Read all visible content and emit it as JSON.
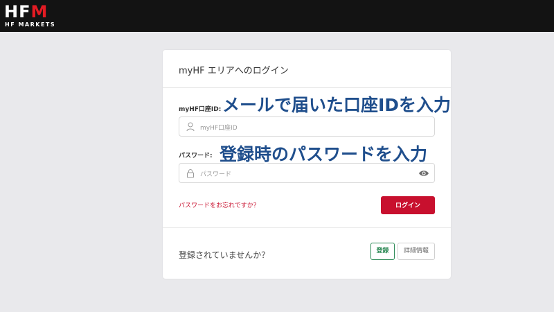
{
  "header": {
    "logo_text": "HFM",
    "logo_subtext": "HF MARKETS"
  },
  "login_card": {
    "title": "myHF エリアへのログイン",
    "id_label": "myHF口座ID:",
    "id_placeholder": "myHF口座ID",
    "password_label": "パスワード:",
    "password_placeholder": "パスワード",
    "forgot_link": "パスワードをお忘れですか？",
    "login_button": "ログイン",
    "no_account_text": "登録されていませんか？",
    "register_button": "登録",
    "details_button": "詳細情報"
  },
  "annotations": {
    "id_hint": "メールで届いた口座IDを入力",
    "password_hint": "登録時のパスワードを入力"
  },
  "icons": {
    "user": "user-icon",
    "lock": "lock-icon",
    "eye": "eye-icon"
  },
  "colors": {
    "brand_red": "#c8102e",
    "register_green": "#2e8b57",
    "annotation_blue": "#1f4e8c",
    "header_bg": "#131313"
  }
}
